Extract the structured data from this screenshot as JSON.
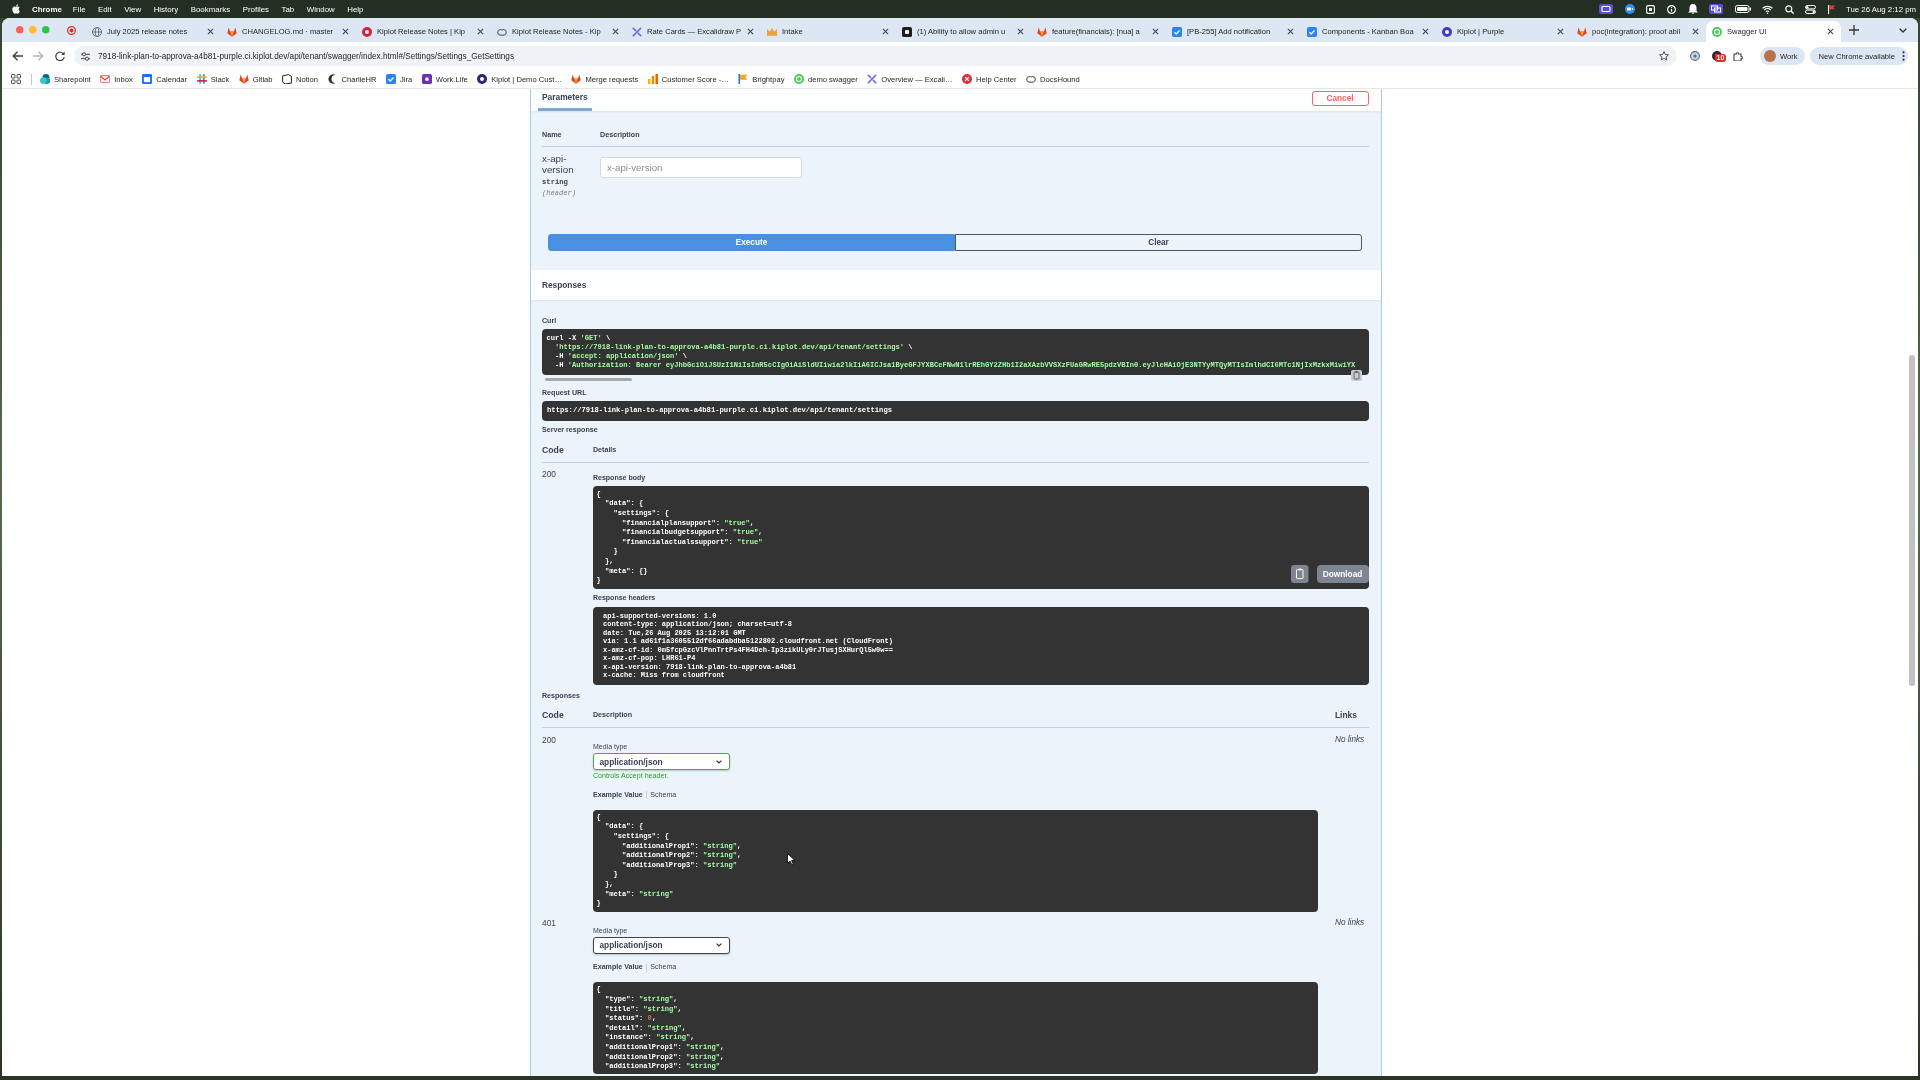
{
  "menu_bar": {
    "app_name": "Chrome",
    "items": [
      "File",
      "Edit",
      "View",
      "History",
      "Bookmarks",
      "Profiles",
      "Tab",
      "Window",
      "Help"
    ],
    "clock": "Tue 26 Aug 2:12 pm"
  },
  "tabs": [
    {
      "kind": "globe",
      "title": "July 2025 release notes",
      "selected": false
    },
    {
      "kind": "gitlab",
      "title": "CHANGELOG.md · master",
      "selected": false
    },
    {
      "kind": "kiplot-red",
      "title": "Kiplot Release Notes | Kip",
      "selected": false
    },
    {
      "kind": "loop",
      "title": "Kiplot Release Notes - Kip",
      "selected": false
    },
    {
      "kind": "excalidraw",
      "title": "Rate Cards — Excalidraw P",
      "selected": false
    },
    {
      "kind": "crown",
      "title": "Intake",
      "selected": false
    },
    {
      "kind": "square",
      "title": "(1) Ability to allow admin u",
      "selected": false
    },
    {
      "kind": "gitlab",
      "title": "feature(financials): [nua] a",
      "selected": false
    },
    {
      "kind": "jira",
      "title": "[PB-255] Add notification",
      "selected": false
    },
    {
      "kind": "jira",
      "title": "Components - Kanban Boa",
      "selected": false
    },
    {
      "kind": "kiplot-blue",
      "title": "Kiplot | Purple",
      "selected": false
    },
    {
      "kind": "gitlab",
      "title": "poc(integration): proof abil",
      "selected": false
    },
    {
      "kind": "swagger",
      "title": "Swagger UI",
      "selected": true
    }
  ],
  "toolbar": {
    "back_disabled": false,
    "forward_disabled": true,
    "url": "7918-link-plan-to-approva-a4b81-purple.ci.kiplot.dev/api/tenant/swagger/index.html#/Settings/Settings_GetSettings",
    "extension_badge": "10",
    "profile": "Work",
    "update_button": "New Chrome available"
  },
  "bookmarks": [
    {
      "kind": "sharepoint",
      "label": "Sharepoint"
    },
    {
      "kind": "gmail",
      "label": "Inbox"
    },
    {
      "kind": "calendar",
      "label": "Calendar"
    },
    {
      "kind": "slack",
      "label": "Slack"
    },
    {
      "kind": "gitlab",
      "label": "Gitlab"
    },
    {
      "kind": "notion",
      "label": "Notion"
    },
    {
      "kind": "charlie",
      "label": "CharlieHR"
    },
    {
      "kind": "jira",
      "label": "Jira"
    },
    {
      "kind": "worklife",
      "label": "Work.Life"
    },
    {
      "kind": "kiplot-dark",
      "label": "Kiplot | Demo Cust…"
    },
    {
      "kind": "gitlab",
      "label": "Merge requests"
    },
    {
      "kind": "score",
      "label": "Customer Score -…"
    },
    {
      "kind": "brightpay",
      "label": "Brightpay"
    },
    {
      "kind": "swagger",
      "label": "demo swagger"
    },
    {
      "kind": "excalidraw",
      "label": "Overview — Excali…"
    },
    {
      "kind": "help",
      "label": "Help Center"
    },
    {
      "kind": "loop",
      "label": "DocsHound"
    }
  ],
  "operation": {
    "section_tabs": [
      {
        "label": "Parameters",
        "selected": true
      }
    ],
    "cancel_button": "Cancel",
    "param_columns": [
      "Name",
      "Description"
    ],
    "parameters": [
      {
        "name": "x-api-version",
        "type": "string",
        "location": "(header)",
        "placeholder": "x-api-version"
      }
    ],
    "execute_button": "Execute",
    "clear_button": "Clear",
    "responses_heading": "Responses",
    "curl": {
      "label": "Curl",
      "kind": "bash",
      "lines": [
        "curl -X 'GET' \\",
        "  'https://7918-link-plan-to-approva-a4b81-purple.ci.kiplot.dev/api/tenant/settings' \\",
        "  -H 'accept: application/json' \\",
        "  -H 'Authorization: Bearer eyJhbGciOiJSUzI1NiIsInR5cCIgOiAiSldUIiwia2lkIiA6ICJsa1ByeGFJYXBCeFNwN1lrREhGY2ZHb1I2aXAzbVVSXzFUaGRwRE5pdzVBIn0.eyJleHAiOjE3NTYyMTQyMTIsImlhdCI6MTc1NjIxMzkxMiwiYX"
      ]
    },
    "request_url": {
      "label": "Request URL",
      "value": "https://7918-link-plan-to-approva-a4b81-purple.ci.kiplot.dev/api/tenant/settings"
    },
    "server_response": {
      "label": "Server response",
      "columns": [
        "Code",
        "Details"
      ],
      "code": "200",
      "body": {
        "label": "Response body",
        "kind": "json",
        "lines": [
          "{",
          "  \"data\": {",
          "    \"settings\": {",
          "      \"financialplansupport\": \"true\",",
          "      \"financialbudgetsupport\": \"true\",",
          "      \"financialactualssupport\": \"true\"",
          "    }",
          "  },",
          "  \"meta\": {}",
          "}"
        ]
      },
      "download_button": "Download",
      "headers": {
        "label": "Response headers",
        "lines": [
          "api-supported-versions: 1.0",
          "content-type: application/json; charset=utf-8",
          "date: Tue,26 Aug 2025 13:12:01 GMT",
          "via: 1.1 ad61f1a3605512df66adabdba5122802.cloudfront.net (CloudFront)",
          "x-amz-cf-id: 0m5fcpGzcVlPnnTrtPs4FH4Deh-Ip3zikULy0rJTusjSXHurQl5w0w==",
          "x-amz-cf-pop: LHR61-P4",
          "x-api-version: 7918-link-plan-to-approva-a4b81",
          "x-cache: Miss from cloudfront"
        ]
      }
    },
    "responses": {
      "label": "Responses",
      "columns": [
        "Code",
        "Description",
        "Links"
      ],
      "items": [
        {
          "code": "200",
          "links": "No links",
          "media_label": "Media type",
          "media_type": "application/json",
          "highlighted": true,
          "hint": "Controls Accept header.",
          "example_tabs": [
            {
              "label": "Example Value",
              "selected": true
            },
            {
              "label": "Schema",
              "selected": false
            }
          ],
          "example": {
            "kind": "json",
            "lines": [
              "{",
              "  \"data\": {",
              "    \"settings\": {",
              "      \"additionalProp1\": \"string\",",
              "      \"additionalProp2\": \"string\",",
              "      \"additionalProp3\": \"string\"",
              "    }",
              "  },",
              "  \"meta\": \"string\"",
              "}"
            ]
          }
        },
        {
          "code": "401",
          "links": "No links",
          "media_label": "Media type",
          "media_type": "application/json",
          "highlighted": false,
          "example_tabs": [
            {
              "label": "Example Value",
              "selected": true
            },
            {
              "label": "Schema",
              "selected": false
            }
          ],
          "example": {
            "kind": "json",
            "lines": [
              "{",
              "  \"type\": \"string\",",
              "  \"title\": \"string\",",
              "  \"status\": 0,",
              "  \"detail\": \"string\",",
              "  \"instance\": \"string\",",
              "  \"additionalProp1\": \"string\",",
              "  \"additionalProp2\": \"string\",",
              "  \"additionalProp3\": \"string\""
            ]
          }
        }
      ]
    }
  }
}
